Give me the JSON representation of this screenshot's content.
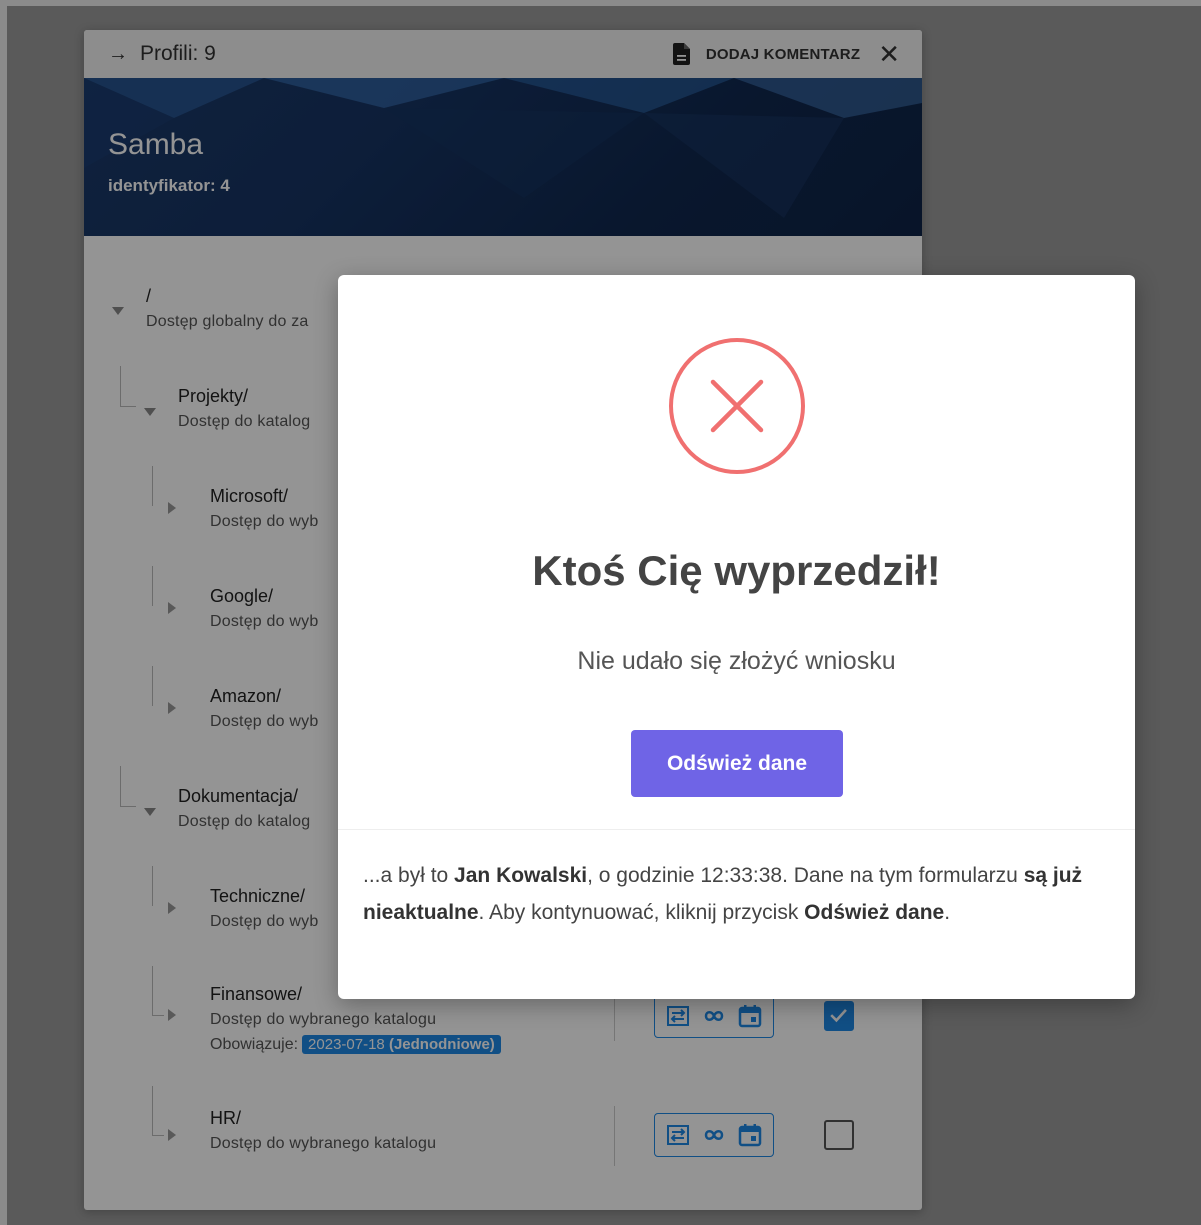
{
  "panel": {
    "topbar": {
      "profiles_label": "Profili: 9",
      "comment_button": "DODAJ KOMENTARZ"
    },
    "header": {
      "title": "Samba",
      "identifier": "identyfikator: 4"
    },
    "tree": [
      {
        "name": "/",
        "desc": "Dostęp globalny do za"
      },
      {
        "name": "Projekty/",
        "desc": "Dostęp do katalog"
      },
      {
        "name": "Microsoft/",
        "desc": "Dostęp do wyb"
      },
      {
        "name": "Google/",
        "desc": "Dostęp do wyb"
      },
      {
        "name": "Amazon/",
        "desc": "Dostęp do wyb"
      },
      {
        "name": "Dokumentacja/",
        "desc": "Dostęp do katalog"
      },
      {
        "name": "Techniczne/",
        "desc": "Dostęp do wyb"
      },
      {
        "name": "Finansowe/",
        "desc": "Dostęp do wybranego katalogu",
        "valid_label": "Obowiązuje:",
        "valid_date": "2023-07-18",
        "valid_type": "(Jednodniowe)",
        "checked": true
      },
      {
        "name": "HR/",
        "desc": "Dostęp do wybranego katalogu",
        "checked": false
      }
    ]
  },
  "modal": {
    "title": "Ktoś Cię wyprzedził!",
    "subtitle": "Nie udało się złożyć wniosku",
    "button": "Odśwież dane",
    "footer": {
      "p1": "...a był to ",
      "user": "Jan Kowalski",
      "p2": ", o godzinie 12:33:38. Dane na tym formularzu ",
      "stale": "są już nieaktualne",
      "p3": ". Aby kontynuować, kliknij przycisk ",
      "button_ref": "Odśwież dane",
      "p4": "."
    }
  },
  "colors": {
    "accent": "#6f64e6",
    "error": "#f07070",
    "header_bg": "#10284f",
    "badge": "#1e88e5"
  }
}
